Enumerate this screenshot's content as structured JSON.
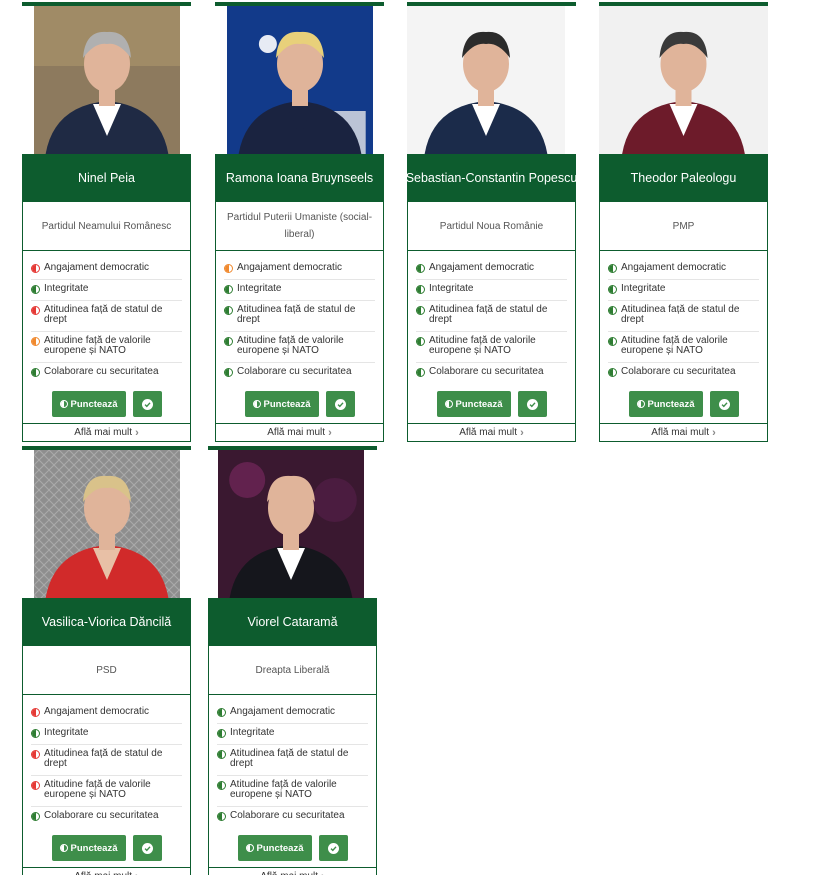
{
  "colors": {
    "brand_green": "#0d5c2e",
    "button_green": "#3e8e4a",
    "status_good": "#2e7d32",
    "status_bad": "#e53935",
    "status_medium": "#f0892e"
  },
  "labels": {
    "criteria": [
      "Angajament democratic",
      "Integritate",
      "Atitudinea față de statul de drept",
      "Atitudine față de valorile europene și NATO",
      "Colaborare cu securitatea"
    ],
    "score_button": "Punctează",
    "more_link": "Află mai mult"
  },
  "candidates": [
    {
      "name": "Ninel Peia",
      "party": "Partidul Neamului Românesc",
      "status": [
        "bad",
        "good",
        "bad",
        "medium",
        "good"
      ],
      "photo": "man-grey-hair-suit"
    },
    {
      "name": "Ramona Ioana Bruynseels",
      "party": "Partidul Puterii Umaniste (social-liberal)",
      "status": [
        "medium",
        "good",
        "good",
        "good",
        "good"
      ],
      "photo": "woman-blonde-podium"
    },
    {
      "name": "Sebastian-Constantin Popescu",
      "party": "Partidul Noua Românie",
      "status": [
        "good",
        "good",
        "good",
        "good",
        "good"
      ],
      "photo": "young-man-beard-suit"
    },
    {
      "name": "Theodor Paleologu",
      "party": "PMP",
      "status": [
        "good",
        "good",
        "good",
        "good",
        "good"
      ],
      "photo": "man-beard-red-jacket"
    },
    {
      "name": "Vasilica-Viorica Dăncilă",
      "party": "PSD",
      "status": [
        "bad",
        "good",
        "bad",
        "bad",
        "good"
      ],
      "photo": "woman-red-dress"
    },
    {
      "name": "Viorel Cataramă",
      "party": "Dreapta Liberală",
      "status": [
        "good",
        "good",
        "good",
        "good",
        "good"
      ],
      "photo": "man-bald-stage"
    }
  ]
}
